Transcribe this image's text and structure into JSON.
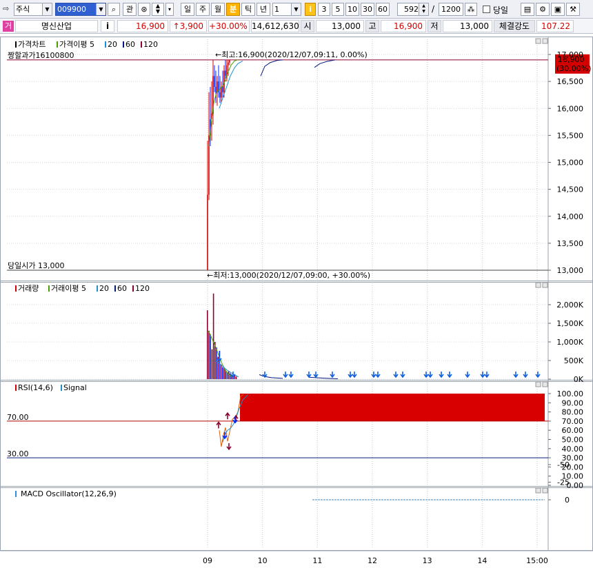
{
  "toolbar": {
    "market_select": "주식",
    "code_value": "009900",
    "btn_gwan": "관",
    "period_tabs": [
      "일",
      "주",
      "월",
      "분",
      "틱",
      "년"
    ],
    "active_period": "분",
    "interval_value": "1",
    "interval_buttons": [
      "3",
      "5",
      "10",
      "30",
      "60"
    ],
    "count_value": "592",
    "count_sep": "/",
    "count_max": "1200",
    "today_label": "당일"
  },
  "quote": {
    "name_tag": "거",
    "name": "명신산업",
    "info_btn": "i",
    "price": "16,900",
    "change": "↑3,900",
    "change_pct": "+30.00%",
    "volume": "14,612,630",
    "open_label": "시",
    "open": "13,000",
    "high_label": "고",
    "high": "16,900",
    "low_label": "저",
    "low": "13,000",
    "strength_label": "체결강도",
    "strength": "107.22"
  },
  "price_panel": {
    "legend_title": "가격차트",
    "legend_ma_label": "가격이평",
    "legend_ma": [
      "5",
      "20",
      "60",
      "120"
    ],
    "upper_limit_label": "짱할과가16100800",
    "open_line_label": "당일시가 13,000",
    "high_note": "←최고:16,900(2020/12/07,09:11, 0.00%)",
    "low_note": "←최저:13,000(2020/12/07,09:00, +30.00%)",
    "current_price": "16,900",
    "current_pct": "(30.00%)",
    "yticks": [
      "17,000",
      "16,500",
      "16,000",
      "15,500",
      "15,000",
      "14,500",
      "14,000",
      "13,500",
      "13,000"
    ]
  },
  "volume_panel": {
    "legend_title": "거래량",
    "legend_ma_label": "거래이평",
    "legend_ma": [
      "5",
      "20",
      "60",
      "120"
    ],
    "yticks": [
      "2,000K",
      "1,500K",
      "1,000K",
      "500K",
      "0K"
    ]
  },
  "rsi_panel": {
    "legend_title": "RSI(14,6)",
    "legend_signal": "Signal",
    "level_high": "70.00",
    "level_low": "30.00",
    "yticks": [
      "100.00",
      "90.00",
      "80.00",
      "70.00",
      "60.00",
      "50.00",
      "40.00",
      "30.00",
      "20.00",
      "10.00",
      "0.00"
    ]
  },
  "macd_panel": {
    "legend_title": "MACD Oscillator(12,26,9)",
    "yticks": [
      "0",
      "-25",
      "-50"
    ]
  },
  "xaxis": {
    "ticks": [
      "09",
      "10",
      "11",
      "12",
      "13",
      "14",
      "15:00"
    ]
  },
  "colors": {
    "up": "#d40000",
    "down": "#0026ff",
    "ma5": "#48a000",
    "ma20": "#1c8fd0",
    "ma60": "#001a80",
    "ma120": "#8a0030",
    "rsi_fill": "#d80000",
    "macd": "#2a8fe0"
  }
}
